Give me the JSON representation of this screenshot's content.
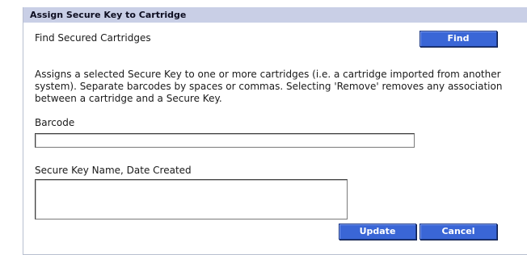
{
  "panel": {
    "title": "Assign Secure Key to Cartridge"
  },
  "find": {
    "label": "Find Secured Cartridges",
    "button": "Find"
  },
  "description": "Assigns a selected Secure Key to one or more cartridges (i.e. a cartridge imported from another system). Separate barcodes by spaces or commas. Selecting 'Remove' removes any association between a cartridge and a Secure Key.",
  "barcode": {
    "label": "Barcode",
    "value": ""
  },
  "secure_key": {
    "label": "Secure Key Name, Date Created",
    "options": []
  },
  "actions": {
    "update": "Update",
    "cancel": "Cancel"
  },
  "colors": {
    "header_bg": "#c9cfe6",
    "button_bg": "#3a66d6",
    "button_text": "#ffffff"
  }
}
